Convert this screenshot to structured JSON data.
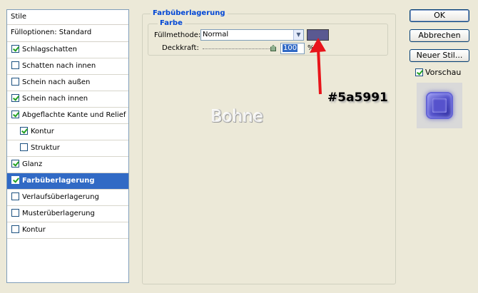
{
  "styles_panel": {
    "header": "Stile",
    "blend_options": "Fülloptionen: Standard",
    "items": [
      {
        "label": "Schlagschatten",
        "checked": true
      },
      {
        "label": "Schatten nach innen",
        "checked": false
      },
      {
        "label": "Schein nach außen",
        "checked": false
      },
      {
        "label": "Schein nach innen",
        "checked": true
      },
      {
        "label": "Abgeflachte Kante und Relief",
        "checked": true
      },
      {
        "label": "Kontur",
        "checked": true
      },
      {
        "label": "Struktur",
        "checked": false
      },
      {
        "label": "Glanz",
        "checked": true
      },
      {
        "label": "Farbüberlagerung",
        "checked": true
      },
      {
        "label": "Verlaufsüberlagerung",
        "checked": false
      },
      {
        "label": "Musterüberlagerung",
        "checked": false
      },
      {
        "label": "Kontur",
        "checked": false
      }
    ]
  },
  "color_overlay": {
    "group_title": "Farbüberlagerung",
    "sub_title": "Farbe",
    "fill_method_label": "Füllmethode:",
    "fill_method_value": "Normal",
    "opacity_label": "Deckkraft:",
    "opacity_value": "100",
    "opacity_unit": "%",
    "swatch_color": "#5a5991"
  },
  "annotation": {
    "hex_code": "#5a5991",
    "watermark": "Bohne"
  },
  "buttons": {
    "ok": "OK",
    "cancel": "Abbrechen",
    "new_style": "Neuer Stil...",
    "preview_label": "Vorschau"
  }
}
